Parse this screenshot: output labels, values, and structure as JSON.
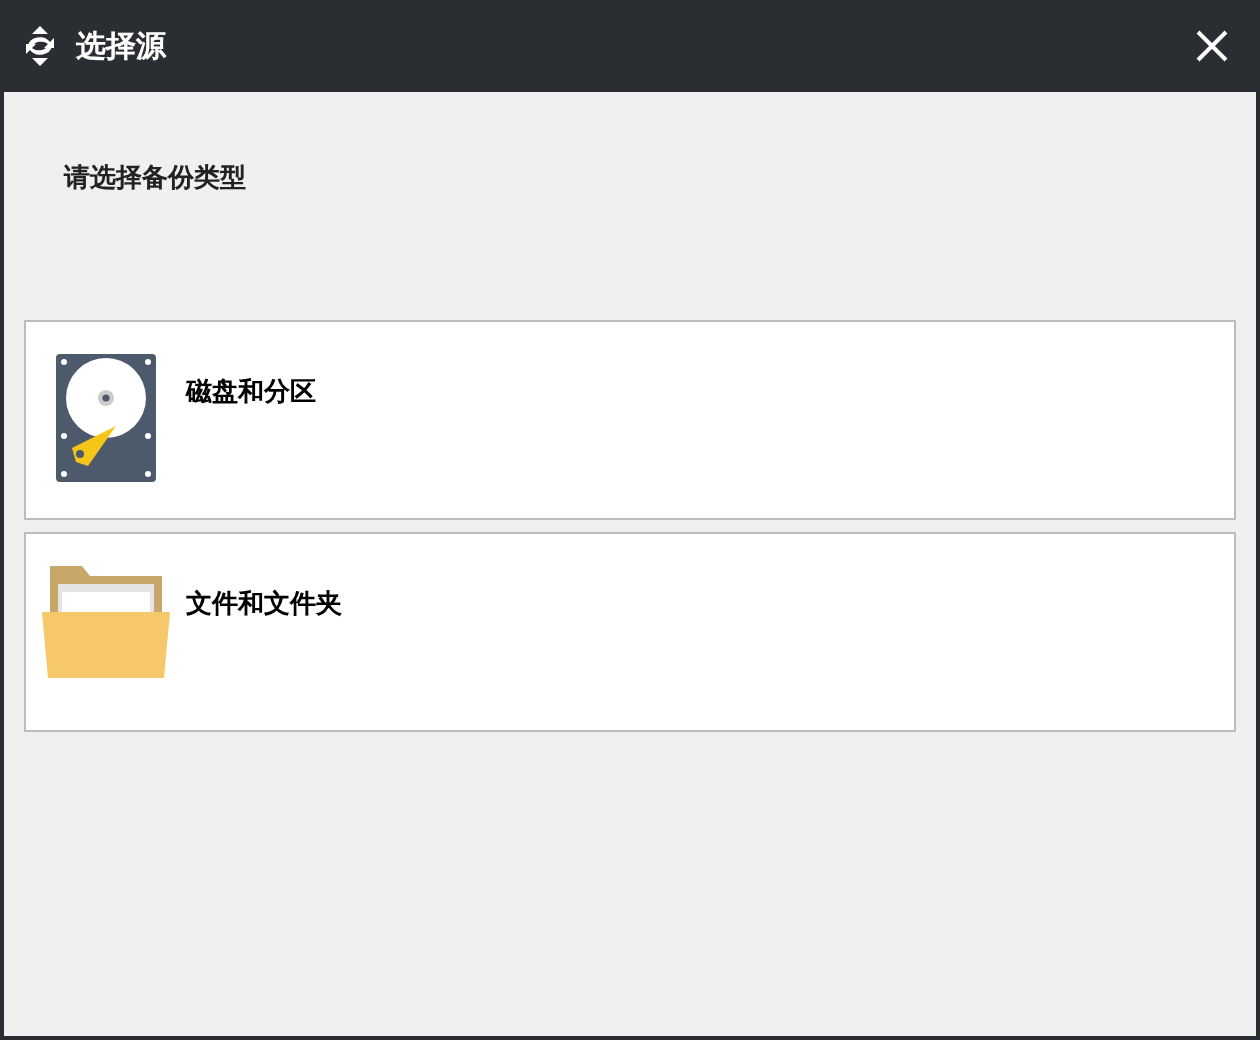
{
  "window": {
    "title": "选择源"
  },
  "prompt": "请选择备份类型",
  "options": [
    {
      "kind": "disk",
      "label": "磁盘和分区"
    },
    {
      "kind": "folder",
      "label": "文件和文件夹"
    }
  ]
}
